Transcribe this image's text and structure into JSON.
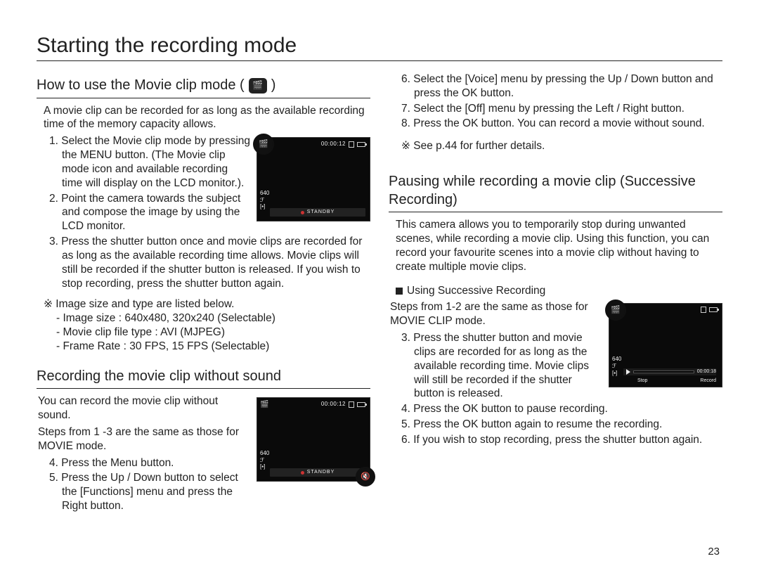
{
  "title": "Starting the recording mode",
  "page_number": "23",
  "left": {
    "h_movie": "How to use the Movie clip mode (",
    "h_movie_close": ")",
    "intro": "A movie clip can be recorded for as long as the available recording time of the memory capacity allows.",
    "s1": "1. Select the Movie clip mode by pressing the MENU button. (The Movie clip mode icon and available recording time will display on the LCD monitor.).",
    "s2": "2. Point the camera towards the subject and compose the image by using the LCD monitor.",
    "s3": "3. Press the shutter button once and movie clips are recorded for as long as the available recording time allows. Movie clips will still be recorded if the shutter button is released. If you wish to stop recording, press the shutter button again.",
    "note": "※ Image size and type are listed below.",
    "spec1": "- Image size           : 640x480, 320x240 (Selectable)",
    "spec2": "- Movie clip ﬁle type : AVI (MJPEG)",
    "spec3": "- Frame Rate          : 30 FPS, 15 FPS (Selectable)",
    "h_nosound": "Recording the movie clip without sound",
    "ns_intro": "You can record the movie clip without sound.",
    "ns_same": "Steps from 1 -3 are the same as those for MOVIE mode.",
    "ns4": "4. Press the Menu button.",
    "ns5": "5. Press the Up / Down button to select the [Functions] menu and press the Right button.",
    "ss1_time": "00:00:12",
    "ss1_standby": "STANDBY",
    "ss2_time": "00:00:12",
    "ss2_standby": "STANDBY",
    "ss_left1": "640",
    "ss_left2": "ℱ"
  },
  "right": {
    "s6": "6. Select the [Voice] menu by pressing the Up / Down button and press the OK button.",
    "s7": "7. Select the [Off] menu by pressing the Left / Right button.",
    "s8": "8. Press the OK button. You can record a movie without sound.",
    "see": "※ See p.44 for further details.",
    "h_pause": "Pausing while recording a movie clip (Successive Recording)",
    "p_intro": "This camera allows you to temporarily stop during unwanted scenes, while recording a movie clip. Using this function, you can record your favourite scenes into a movie clip without having to create multiple movie clips.",
    "p_using": "Using Successive Recording",
    "p_same": "Steps from 1-2 are the same as those for MOVIE CLIP mode.",
    "p3": "3. Press the shutter button and movie clips are recorded for as long as the available recording time. Movie clips will still be recorded if the shutter button is released.",
    "p4": "4. Press the OK button to pause recording.",
    "p5": "5. Press the OK button again to resume the recording.",
    "p6": "6. If you wish to stop recording, press the shutter button again.",
    "ss3_time": "00:00:18",
    "ss3_stop": "Stop",
    "ss3_record": "Record",
    "ss_left1": "640",
    "ss_left2": "ℱ"
  }
}
